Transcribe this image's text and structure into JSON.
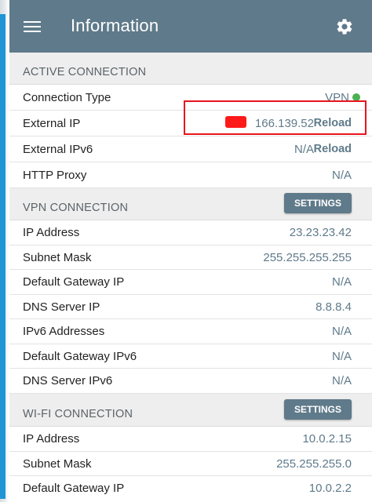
{
  "app": {
    "title": "Information",
    "menu_icon": "hamburger-menu-icon",
    "settings_icon": "gear-icon"
  },
  "active_connection": {
    "header": "ACTIVE CONNECTION",
    "rows": [
      {
        "label": "Connection Type",
        "value": "VPN"
      },
      {
        "label": "External IP",
        "value": "166.139.52",
        "action": "Reload"
      },
      {
        "label": "External IPv6",
        "value": "N/A",
        "action": "Reload"
      },
      {
        "label": "HTTP Proxy",
        "value": "N/A"
      }
    ]
  },
  "vpn_connection": {
    "header": "VPN CONNECTION",
    "settings_label": "SETTINGS",
    "rows": [
      {
        "label": "IP Address",
        "value": "23.23.23.42"
      },
      {
        "label": "Subnet Mask",
        "value": "255.255.255.255"
      },
      {
        "label": "Default Gateway IP",
        "value": "N/A"
      },
      {
        "label": "DNS Server IP",
        "value": "8.8.8.4"
      },
      {
        "label": "IPv6 Addresses",
        "value": "N/A"
      },
      {
        "label": "Default Gateway IPv6",
        "value": "N/A"
      },
      {
        "label": "DNS Server IPv6",
        "value": "N/A"
      }
    ]
  },
  "wifi_connection": {
    "header": "WI-FI CONNECTION",
    "settings_label": "SETTINGS",
    "rows": [
      {
        "label": "IP Address",
        "value": "10.0.2.15"
      },
      {
        "label": "Subnet Mask",
        "value": "255.255.255.0"
      },
      {
        "label": "Default Gateway IP",
        "value": "10.0.2.2"
      }
    ]
  },
  "colors": {
    "appbar": "#5f7a8a",
    "value_text": "#5f7a8a",
    "status_connected": "#4caf50",
    "highlight_box": "#e8141c",
    "redaction": "#ff1a1a"
  }
}
